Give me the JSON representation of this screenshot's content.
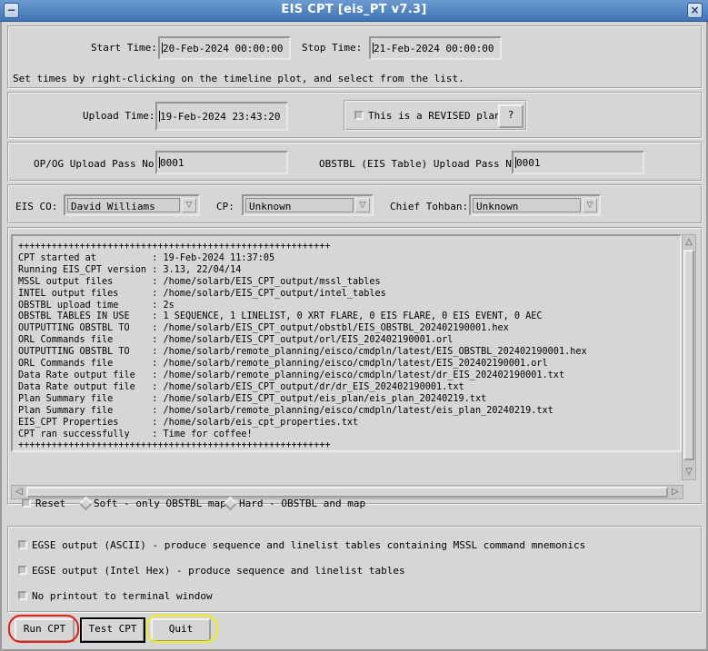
{
  "window": {
    "title": "EIS CPT [eis_PT v7.3]",
    "menu_icon": "window-menu-icon",
    "close_icon": "close-icon"
  },
  "times": {
    "start_label": "Start Time:",
    "start_value": "20-Feb-2024 00:00:00",
    "stop_label": "Stop Time:",
    "stop_value": "21-Feb-2024 00:00:00",
    "hint": "Set times by right-clicking on the timeline plot, and select from the list."
  },
  "upload": {
    "label": "Upload Time:",
    "value": "19-Feb-2024 23:43:20",
    "revised_label": "This is a REVISED plan",
    "help_button": "?"
  },
  "passes": {
    "opog_label": "OP/OG Upload Pass No:",
    "opog_value": "0001",
    "obstbl_label": "OBSTBL (EIS Table) Upload Pass No:",
    "obstbl_value": "0001"
  },
  "staff": {
    "eis_co_label": "EIS CO:",
    "eis_co_value": "David Williams",
    "cp_label": "CP:",
    "cp_value": "Unknown",
    "tohban_label": "Chief Tohban:",
    "tohban_value": "Unknown"
  },
  "console": {
    "lines": [
      "++++++++++++++++++++++++++++++++++++++++++++++++++++++++",
      "CPT started at          : 19-Feb-2024 11:37:05",
      "Running EIS_CPT version : 3.13, 22/04/14",
      "MSSL output files       : /home/solarb/EIS_CPT_output/mssl_tables",
      "INTEL output files      : /home/solarb/EIS_CPT_output/intel_tables",
      "OBSTBL upload time      : 2s",
      "OBSTBL TABLES IN USE    : 1 SEQUENCE, 1 LINELIST, 0 XRT FLARE, 0 EIS FLARE, 0 EIS EVENT, 0 AEC",
      "OUTPUTTING OBSTBL TO    : /home/solarb/EIS_CPT_output/obstbl/EIS_OBSTBL_202402190001.hex",
      "ORL Commands file       : /home/solarb/EIS_CPT_output/orl/EIS_202402190001.orl",
      "OUTPUTTING OBSTBL TO    : /home/solarb/remote_planning/eisco/cmdpln/latest/EIS_OBSTBL_202402190001.hex",
      "ORL Commands file       : /home/solarb/remote_planning/eisco/cmdpln/latest/EIS_202402190001.orl",
      "Data Rate output file   : /home/solarb/remote_planning/eisco/cmdpln/latest/dr_EIS_202402190001.txt",
      "Data Rate output file   : /home/solarb/EIS_CPT_output/dr/dr_EIS_202402190001.txt",
      "Plan Summary file       : /home/solarb/EIS_CPT_output/eis_plan/eis_plan_20240219.txt",
      "Plan Summary file       : /home/solarb/remote_planning/eisco/cmdpln/latest/eis_plan_20240219.txt",
      "EIS_CPT Properties      : /home/solarb/eis_cpt_properties.txt",
      "CPT ran successfully    : Time for coffee!",
      "++++++++++++++++++++++++++++++++++++++++++++++++++++++++"
    ]
  },
  "reset_options": {
    "reset_label": "Reset",
    "soft_label": "Soft - only OBSTBL map",
    "hard_label": "Hard - OBSTBL and map"
  },
  "output_options": {
    "egse_ascii": "EGSE output (ASCII) - produce sequence and linelist tables containing MSSL command mnemonics",
    "egse_intel": "EGSE output (Intel Hex) - produce sequence and linelist tables",
    "no_printout": "No printout to terminal window"
  },
  "actions": {
    "run": "Run CPT",
    "test": "Test CPT",
    "quit": "Quit"
  },
  "colors": {
    "titlebar": "#3f74b4",
    "background": "#d6d6d6",
    "annotation_red": "#e81c0c",
    "annotation_yellow": "#f4ee0c"
  }
}
